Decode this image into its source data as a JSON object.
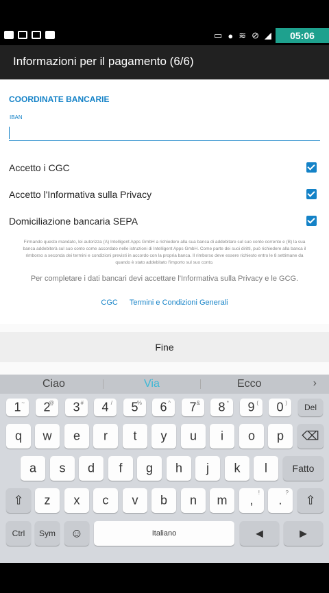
{
  "status": {
    "time": "05:06"
  },
  "appbar": {
    "title": "Informazioni per il pagamento (6/6)"
  },
  "form": {
    "section_title": "COORDINATE BANCARIE",
    "iban_label": "IBAN",
    "iban_value": "",
    "checks": [
      {
        "label": "Accetto i CGC",
        "checked": true
      },
      {
        "label": "Accetto l'Informativa sulla Privacy",
        "checked": true
      },
      {
        "label": "Domiciliazione bancaria SEPA",
        "checked": true
      }
    ],
    "mandate_text": "Firmando questo mandato, lei autorizza (A) Intelligent Apps GmbH a richiedere alla sua banca di addebitare sul suo conto corrente e (B) la sua banca addebiterà sul suo conto come accordato nelle istruzioni di Intelligent Apps GmbH. Come parte dei suoi diritti, può richiedere alla banca il rimborso a seconda dei termini e condizioni previsti in accordo con la propria banca. Il rimborso deve essere richiesto entro le 8 settimane da quando è stato addebitato l'importo sul suo conto.",
    "note": "Per completare i dati bancari devi accettare l'Informativa sulla Privacy e le GCG.",
    "link_cgc": "CGC",
    "link_terms": "Termini e Condizioni Generali"
  },
  "done_label": "Fine",
  "keyboard": {
    "suggestions": [
      "Ciao",
      "Via",
      "Ecco"
    ],
    "row_numbers": [
      {
        "k": "1",
        "s": "~"
      },
      {
        "k": "2",
        "s": "@"
      },
      {
        "k": "3",
        "s": "#"
      },
      {
        "k": "4",
        "s": "/"
      },
      {
        "k": "5",
        "s": "%"
      },
      {
        "k": "6",
        "s": "^"
      },
      {
        "k": "7",
        "s": "&"
      },
      {
        "k": "8",
        "s": "*"
      },
      {
        "k": "9",
        "s": "("
      },
      {
        "k": "0",
        "s": ")"
      }
    ],
    "del_label": "Del",
    "row1": [
      "q",
      "w",
      "e",
      "r",
      "t",
      "y",
      "u",
      "i",
      "o",
      "p"
    ],
    "row2": [
      "a",
      "s",
      "d",
      "f",
      "g",
      "h",
      "j",
      "k",
      "l"
    ],
    "done_key": "Fatto",
    "row3": [
      "z",
      "x",
      "c",
      "v",
      "b",
      "n",
      "m"
    ],
    "punct1": {
      "k": ",",
      "s": "!"
    },
    "punct2": {
      "k": ".",
      "s": "?"
    },
    "ctrl": "Ctrl",
    "sym": "Sym",
    "space": "Italiano"
  }
}
